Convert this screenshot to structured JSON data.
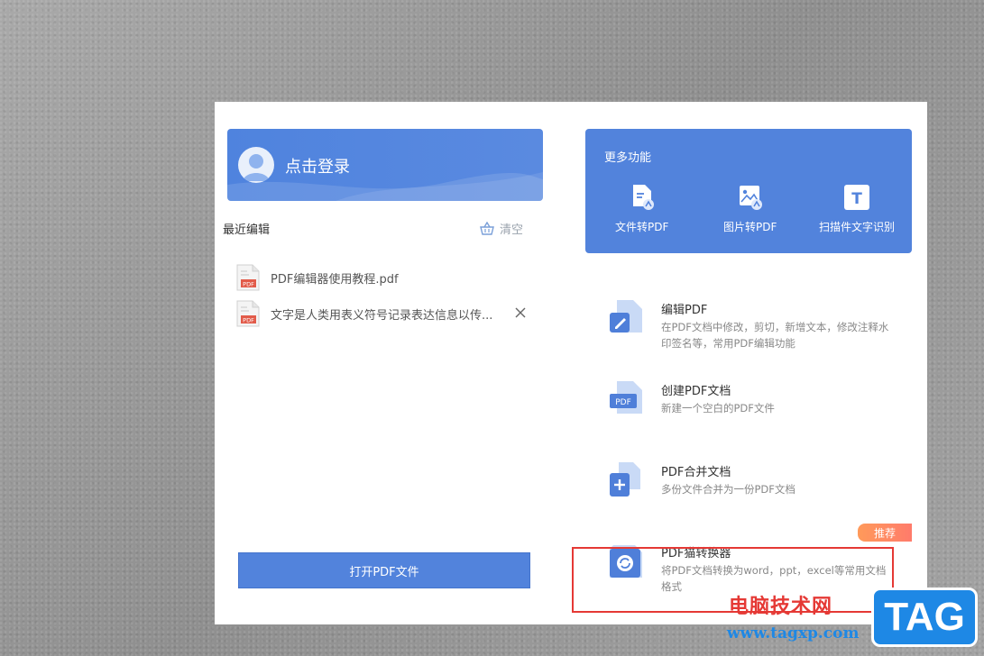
{
  "login": {
    "label": "点击登录"
  },
  "recent": {
    "title": "最近编辑",
    "clear_label": "清空",
    "files": [
      {
        "name": "PDF编辑器使用教程.pdf",
        "icon_label": "PDF"
      },
      {
        "name": "文字是人类用表义符号记录表达信息以传...",
        "icon_label": "PDF"
      }
    ]
  },
  "open_button": {
    "label": "打开PDF文件"
  },
  "more": {
    "title": "更多功能",
    "features": [
      {
        "label": "文件转PDF",
        "icon": "file-convert-icon"
      },
      {
        "label": "图片转PDF",
        "icon": "image-convert-icon"
      },
      {
        "label": "扫描件文字识别",
        "icon": "ocr-icon",
        "glyph": "T"
      }
    ]
  },
  "tools": [
    {
      "name": "编辑PDF",
      "desc": "在PDF文档中修改，剪切，新增文本，修改注释水印签名等，常用PDF编辑功能",
      "icon": "edit-pdf-icon"
    },
    {
      "name": "创建PDF文档",
      "desc": "新建一个空白的PDF文件",
      "icon": "create-pdf-icon",
      "icon_label": "PDF"
    },
    {
      "name": "PDF合并文档",
      "desc": "多份文件合并为一份PDF文档",
      "icon": "merge-pdf-icon"
    },
    {
      "name": "PDF猫转换器",
      "desc": "将PDF文档转换为word，ppt，excel等常用文档格式",
      "icon": "converter-icon"
    }
  ],
  "badge": {
    "label": "推荐"
  },
  "watermark": {
    "text": "电脑技术网",
    "url": "www.tagxp.com",
    "logo": "TAG"
  },
  "colors": {
    "accent": "#5283dc",
    "badge": "#ff8a60",
    "highlight": "#e53935"
  }
}
